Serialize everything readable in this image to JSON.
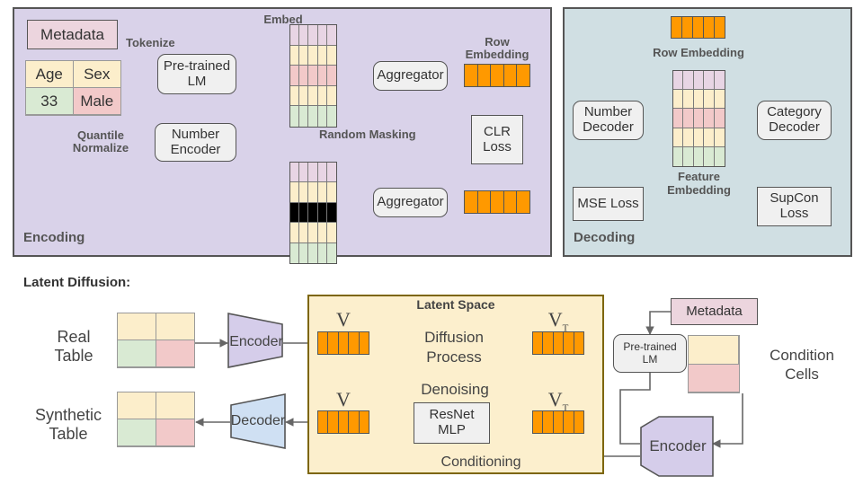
{
  "panels": {
    "encoding": {
      "label": "Encoding",
      "bg": "#d9d2e9"
    },
    "decoding": {
      "label": "Decoding",
      "bg": "#d0dfe3"
    },
    "latent_space": {
      "label": "Latent Space",
      "bg": "#fcefcd"
    }
  },
  "encoding": {
    "metadata_box": "Metadata",
    "table": {
      "headers": [
        "Age",
        "Sex"
      ],
      "values": [
        "33",
        "Male"
      ]
    },
    "tokenize_label": "Tokenize",
    "quantile_label": "Quantile",
    "normalize_label": "Normalize",
    "pretrained_lm": "Pre-trained\nLM",
    "pretrained_lm_line1": "Pre-trained",
    "pretrained_lm_line2": "LM",
    "number_encoder_line1": "Number",
    "number_encoder_line2": "Encoder",
    "embed_label": "Embed",
    "random_masking_label": "Random Masking",
    "aggregator_top": "Aggregator",
    "aggregator_bottom": "Aggregator",
    "row_embedding_label_line1": "Row",
    "row_embedding_label_line2": "Embedding",
    "clr_loss_line1": "CLR",
    "clr_loss_line2": "Loss",
    "embed_grid": {
      "rows": 5,
      "cols": 5,
      "row_colors": [
        "mauve",
        "yellow",
        "red",
        "yellow",
        "green"
      ]
    },
    "masked_grid": {
      "rows": 5,
      "cols": 5,
      "row_colors": [
        "mauve",
        "yellow",
        "black",
        "yellow",
        "green"
      ]
    },
    "row_embedding_cells": 5,
    "masked_embedding_cells": 5
  },
  "decoding": {
    "row_embedding_label": "Row Embedding",
    "row_embedding_cells": 5,
    "feature_embedding_label_line1": "Feature",
    "feature_embedding_label_line2": "Embedding",
    "feature_grid": {
      "rows": 5,
      "cols": 5,
      "row_colors": [
        "mauve",
        "yellow",
        "red",
        "yellow",
        "green"
      ]
    },
    "number_decoder_line1": "Number",
    "number_decoder_line2": "Decoder",
    "category_decoder_line1": "Category",
    "category_decoder_line2": "Decoder",
    "mse_loss": "MSE Loss",
    "supcon_loss_line1": "SupCon",
    "supcon_loss_line2": "Loss"
  },
  "latent_diffusion": {
    "title": "Latent Diffusion:",
    "real_table_line1": "Real",
    "real_table_line2": "Table",
    "synthetic_table_line1": "Synthetic",
    "synthetic_table_line2": "Table",
    "encoder_label": "Encoder",
    "decoder_label": "Decoder",
    "v_label": "V",
    "vt_label_base": "V",
    "vt_label_sub": "T",
    "diffusion_line1": "Diffusion",
    "diffusion_line2": "Process",
    "denoising_label": "Denoising",
    "resnet_line1": "ResNet",
    "resnet_line2": "MLP",
    "conditioning_label": "Conditioning",
    "metadata_box": "Metadata",
    "pretrained_lm_line1": "Pre-trained",
    "pretrained_lm_line2": "LM",
    "condition_cells_line1": "Condition",
    "condition_cells_line2": "Cells",
    "cond_encoder_label": "Encoder",
    "latent_bar_cells": 5,
    "real_table_colors": [
      "yellow",
      "yellow",
      "green",
      "red"
    ],
    "synthetic_table_colors": [
      "yellow",
      "yellow",
      "green",
      "red"
    ],
    "condition_cell_colors": [
      "yellow",
      "red"
    ]
  },
  "colors": {
    "mauve": "#e8d5e4",
    "yellow": "#fceecb",
    "red": "#f2c9c9",
    "green": "#d9ead3",
    "black": "#000000",
    "orange": "#ff9900",
    "pink_box": "#ecd5de",
    "encoder_purple": "#d5cdea",
    "decoder_blue": "#cfe0f3",
    "gray_box": "#f0f0f0",
    "stroke": "#555555"
  }
}
